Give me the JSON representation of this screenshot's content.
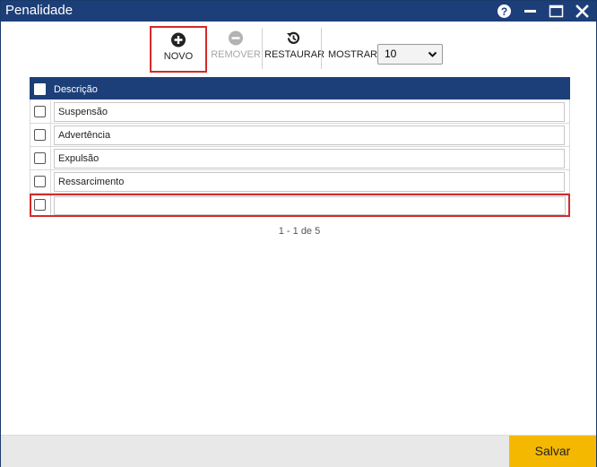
{
  "window": {
    "title": "Penalidade",
    "icons": [
      "help-icon",
      "minimize-icon",
      "maximize-icon",
      "close-icon"
    ]
  },
  "toolbar": {
    "novo_label": "NOVO",
    "remover_label": "REMOVER",
    "restaurar_label": "RESTAURAR",
    "mostrar_label": "MOSTRAR:",
    "mostrar_value": "10"
  },
  "grid": {
    "header": "Descrição",
    "rows": [
      {
        "descricao": "Suspensão"
      },
      {
        "descricao": "Advertência"
      },
      {
        "descricao": "Expulsão"
      },
      {
        "descricao": "Ressarcimento"
      }
    ],
    "new_row_value": ""
  },
  "pager": "1 - 1 de 5",
  "footer": {
    "save_label": "Salvar"
  },
  "colors": {
    "titlebar": "#1d3f79",
    "highlight": "#d42a2a",
    "save": "#f5b800"
  }
}
